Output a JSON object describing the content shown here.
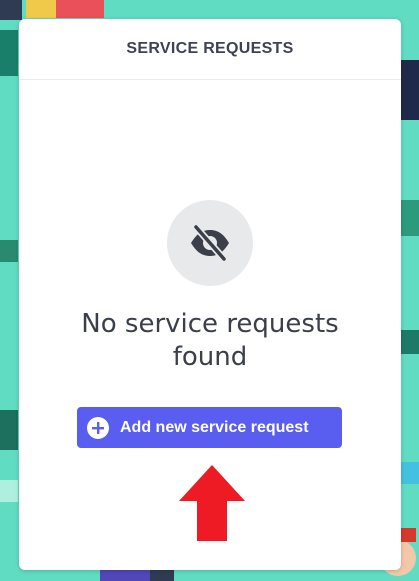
{
  "panel": {
    "title": "SERVICE REQUESTS"
  },
  "empty_state": {
    "icon": "eye-slash-icon",
    "message": "No service requests found"
  },
  "actions": {
    "add_label": "Add new service request",
    "add_icon": "plus-circle-icon"
  },
  "annotation": {
    "arrow_icon": "red-up-arrow",
    "arrow_color": "#ee1b24"
  },
  "colors": {
    "accent": "#5a5ef0",
    "background": "#5fdcc2",
    "icon_bg": "#e8e9eb",
    "text": "#3a3f4a"
  }
}
